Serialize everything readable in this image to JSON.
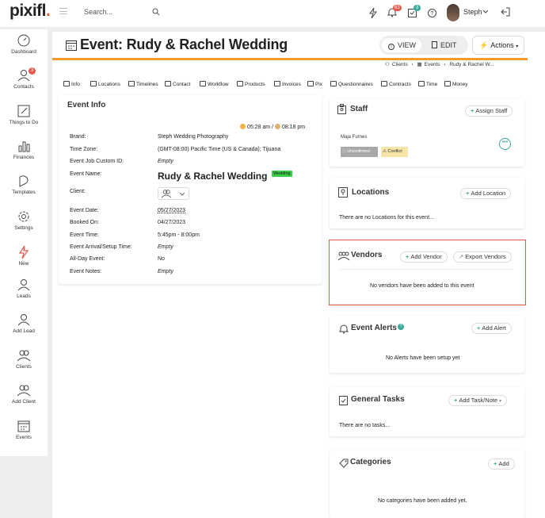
{
  "brand": {
    "logo_text": "pixifl",
    "logo_dot": ".",
    "accent": "#e8603c"
  },
  "topbar": {
    "search_placeholder": "Search...",
    "notifications_count": "63",
    "tasks_count": "3",
    "user_name": "Steph"
  },
  "sidebar": {
    "items": [
      {
        "label": "Dashboard",
        "icon": "dashboard-icon"
      },
      {
        "label": "Contacts",
        "icon": "contacts-icon",
        "badge": "3"
      },
      {
        "label": "Things to Do",
        "icon": "todo-icon"
      },
      {
        "label": "Finances",
        "icon": "finances-icon"
      },
      {
        "label": "Templates",
        "icon": "templates-icon"
      },
      {
        "label": "Settings",
        "icon": "settings-icon"
      },
      {
        "label": "New",
        "icon": "new-icon"
      },
      {
        "label": "Leads",
        "icon": "leads-icon"
      },
      {
        "label": "Add Lead",
        "icon": "add-lead-icon"
      },
      {
        "label": "Clients",
        "icon": "clients-icon"
      },
      {
        "label": "Add Client",
        "icon": "add-client-icon"
      },
      {
        "label": "Events",
        "icon": "events-icon"
      }
    ]
  },
  "header": {
    "title": "Event: Rudy & Rachel Wedding",
    "view_label": "VIEW",
    "edit_label": "EDIT",
    "actions_label": "Actions",
    "breadcrumb": [
      "Clients",
      "Events",
      "Rudy & Rachel W..."
    ]
  },
  "tabs": [
    "Info",
    "Locations",
    "Timelines",
    "Contact",
    "Workflow",
    "Products",
    "Invoices",
    "Pix",
    "Questionnaires",
    "Contracts",
    "Time",
    "Money"
  ],
  "event_info": {
    "title": "Event Info",
    "sunrise": "05:28 am /",
    "sunset": "08:18 pm",
    "rows": [
      {
        "label": "Brand:",
        "value": "Steph Wedding Photography"
      },
      {
        "label": "Time Zone:",
        "value": "(GMT-08:00) Pacific Time (US & Canada); Tijuana"
      },
      {
        "label": "Event Job Custom ID:",
        "value": "Empty"
      },
      {
        "label": "Event Name:",
        "value": "Rudy & Rachel Wedding",
        "tag": "Wedding"
      },
      {
        "label": "Client:",
        "value": ""
      },
      {
        "label": "Event Date:",
        "value": "05/27/2023"
      },
      {
        "label": "Booked On:",
        "value": "04/27/2023"
      },
      {
        "label": "Event Time:",
        "value": "5:45pm - 8:00pm"
      },
      {
        "label": "Event Arrival/Setup Time:",
        "value": "Empty"
      },
      {
        "label": "All-Day Event:",
        "value": "No"
      },
      {
        "label": "Event Notes:",
        "value": "Empty"
      }
    ]
  },
  "staff": {
    "title": "Staff",
    "assign_label": "Assign Staff",
    "member": "Maja Furnes",
    "unconfirmed_label": "Unconfirmed",
    "conflict_label": "Conflict"
  },
  "locations": {
    "title": "Locations",
    "add_label": "Add Location",
    "empty": "There are no Locations for this event..."
  },
  "vendors": {
    "title": "Vendors",
    "add_label": "Add Vendor",
    "export_label": "Export Vendors",
    "empty": "No vendors have been added to this event"
  },
  "alerts": {
    "title": "Event Alerts",
    "add_label": "Add Alert",
    "empty": "No Alerts have been setup yet"
  },
  "tasks": {
    "title": "General Tasks",
    "add_label": "Add Task/Note",
    "empty": "There are no tasks..."
  },
  "categories": {
    "title": "Categories",
    "add_label": "Add",
    "empty": "No categories have been added yet."
  }
}
